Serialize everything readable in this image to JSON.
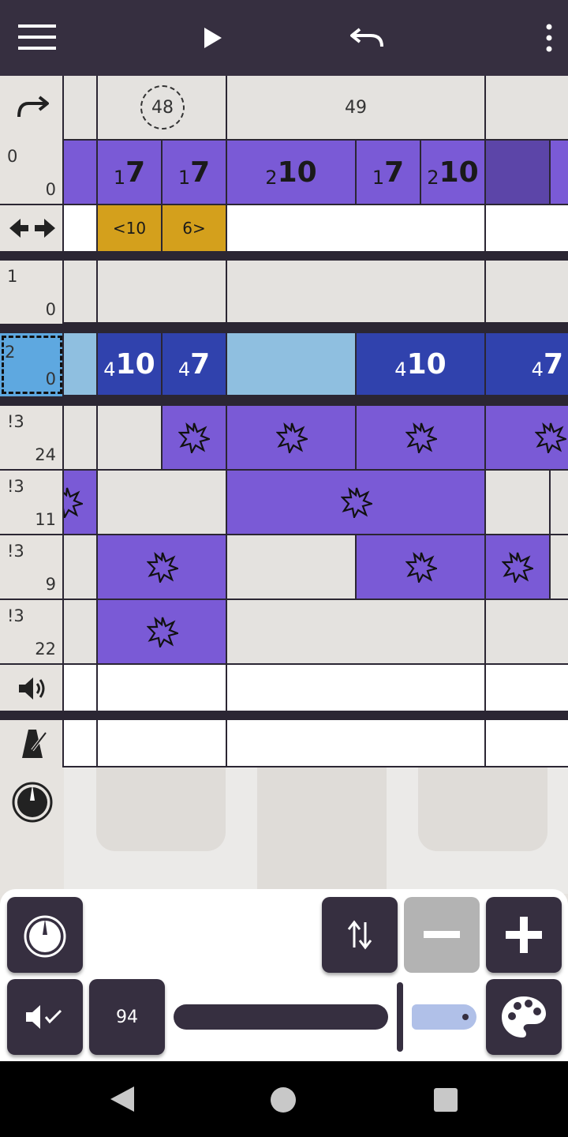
{
  "toolbar": {
    "menu_icon": "hamburger-menu-icon",
    "play_icon": "play-icon",
    "undo_icon": "undo-icon",
    "more_icon": "more-vertical-icon"
  },
  "header_row": {
    "redo_icon": "redo-icon",
    "beat_48": "48",
    "beat_49": "49"
  },
  "channels": [
    {
      "top": "0",
      "bottom": "0"
    },
    {
      "top": "1",
      "bottom": "0"
    },
    {
      "top": "2",
      "bottom": "0"
    },
    {
      "top": "!3",
      "bottom": "24"
    },
    {
      "top": "!3",
      "bottom": "11"
    },
    {
      "top": "!3",
      "bottom": "9"
    },
    {
      "top": "!3",
      "bottom": "22"
    }
  ],
  "row0_notes": [
    {
      "octave": "1",
      "note": "7"
    },
    {
      "octave": "1",
      "note": "7"
    },
    {
      "octave": "2",
      "note": "10"
    },
    {
      "octave": "1",
      "note": "7"
    },
    {
      "octave": "2",
      "note": "10"
    }
  ],
  "tuplet_row": {
    "icon": "swap-horizontal-icon",
    "left": "<10",
    "right": "6>"
  },
  "row2_notes": [
    {
      "octave": "4",
      "note": "10"
    },
    {
      "octave": "4",
      "note": "7"
    },
    {
      "octave": "4",
      "note": "10"
    },
    {
      "octave": "4",
      "note": "7"
    }
  ],
  "volume_row_icon": "speaker-icon",
  "tempo_row_icon": "metronome-icon",
  "dial_row_icon": "dial-icon",
  "panel": {
    "dial_button_icon": "dial-icon",
    "swap_button_icon": "swap-vertical-icon",
    "minus_button_icon": "minus-icon",
    "plus_button_icon": "plus-icon",
    "mute_button_icon": "volume-check-icon",
    "volume_value": "94",
    "volume_fraction": 1.0,
    "palette_button_icon": "palette-icon"
  },
  "navbar": {
    "back_icon": "nav-back-icon",
    "home_icon": "nav-home-icon",
    "recents_icon": "nav-recents-icon"
  },
  "colors": {
    "topbar": "#362f40",
    "purple": "#7a5ad6",
    "blue": "#3042ad",
    "light_blue": "#8fbfe0",
    "gold": "#d4a01c"
  }
}
